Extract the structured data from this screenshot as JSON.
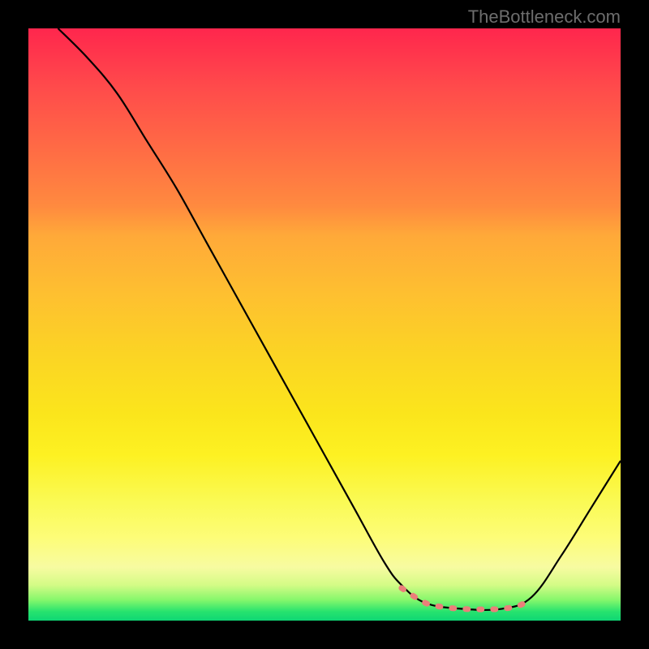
{
  "attribution": "TheBottleneck.com",
  "chart_data": {
    "type": "line",
    "title": "",
    "xlabel": "",
    "ylabel": "",
    "xlim": [
      0,
      100
    ],
    "ylim": [
      0,
      100
    ],
    "grid": false,
    "legend": false,
    "series": [
      {
        "name": "curve",
        "x": [
          5,
          10,
          15,
          20,
          25,
          30,
          35,
          40,
          45,
          50,
          55,
          60,
          63,
          67,
          73,
          80,
          85,
          90,
          95,
          100
        ],
        "values": [
          100,
          95,
          89,
          81,
          73,
          64,
          55,
          46,
          37,
          28,
          19,
          10,
          6,
          3,
          2,
          2,
          4,
          11,
          19,
          27
        ]
      },
      {
        "name": "highlight-range",
        "x": [
          63,
          67,
          70,
          73,
          76,
          80,
          83,
          85
        ],
        "values": [
          5.5,
          3.0,
          2.3,
          2.0,
          1.9,
          2.0,
          2.6,
          3.8
        ]
      }
    ],
    "annotations": []
  }
}
